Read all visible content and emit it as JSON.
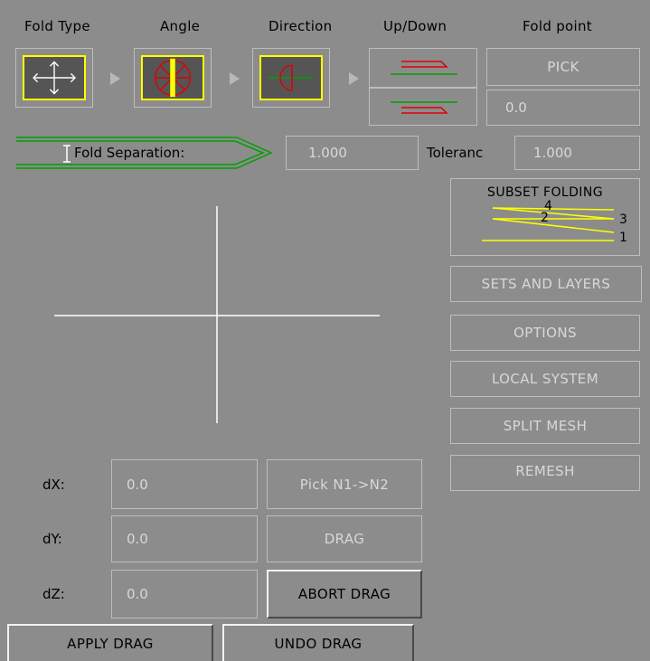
{
  "headers": {
    "fold_type": "Fold Type",
    "angle": "Angle",
    "direction": "Direction",
    "up_down": "Up/Down",
    "fold_point": "Fold point"
  },
  "fold_point": {
    "pick_label": "PICK",
    "value": "0.0"
  },
  "fold_separation": {
    "label": "Fold Separation:",
    "value": "1.000"
  },
  "tolerance": {
    "label": "Toleranc",
    "value": "1.000"
  },
  "subset_folding": {
    "label": "SUBSET FOLDING",
    "digits": [
      "4",
      "2",
      "3",
      "1"
    ]
  },
  "side_buttons": {
    "sets_and_layers": "SETS AND LAYERS",
    "options": "OPTIONS",
    "local_system": "LOCAL SYSTEM",
    "split_mesh": "SPLIT MESH",
    "remesh": "REMESH"
  },
  "drag": {
    "dx_label": "dX:",
    "dx_value": "0.0",
    "dy_label": "dY:",
    "dy_value": "0.0",
    "dz_label": "dZ:",
    "dz_value": "0.0",
    "pick_n1_n2": "Pick N1->N2",
    "drag": "DRAG",
    "abort_drag": "ABORT DRAG",
    "apply_drag": "APPLY DRAG",
    "undo_drag": "UNDO DRAG"
  },
  "colors": {
    "background": "#8c8c8c",
    "accent_yellow": "#ffff00",
    "red": "#e00000",
    "green": "#00a000",
    "disabled_text": "#d8d8d8"
  }
}
